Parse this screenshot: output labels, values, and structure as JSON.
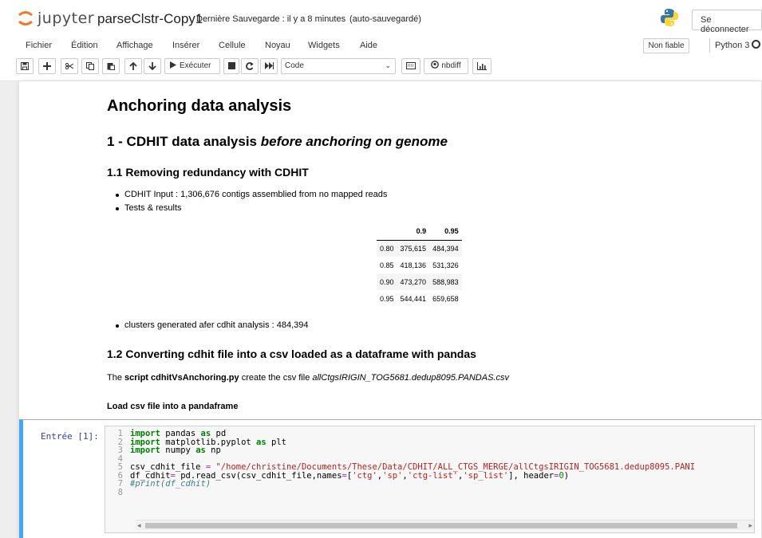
{
  "header": {
    "logo_text": "jupyter",
    "notebook_name": "parseClstr-Copy1",
    "save_status": "Dernière Sauvegarde : il y a 8 minutes",
    "autosave": "(auto-sauvegardé)",
    "logout": "Se déconnecter"
  },
  "menu": {
    "items": [
      "Fichier",
      "Édition",
      "Affichage",
      "Insérer",
      "Cellule",
      "Noyau",
      "Widgets",
      "Aide"
    ],
    "trust": "Non fiable",
    "kernel": "Python 3"
  },
  "toolbar": {
    "run_label": "Exécuter",
    "cell_type": "Code",
    "nbdiff_label": "nbdiff",
    "icons": [
      "save-icon",
      "plus-icon",
      "cut-icon",
      "copy-icon",
      "paste-icon",
      "arrow-up-icon",
      "arrow-down-icon",
      "play-icon",
      "stop-icon",
      "restart-icon",
      "fast-forward-icon",
      "keyboard-icon",
      "github-icon",
      "chart-bar-icon"
    ]
  },
  "markdown": {
    "h1": "Anchoring data analysis",
    "h2_prefix": "1 - CDHIT data analysis ",
    "h2_italic": "before anchoring on genome",
    "h3_1": "1.1 Removing redundancy with CDHIT",
    "bullets1": [
      "CDHIT Input : 1,306,676 contigs assemblied from no mapped reads",
      "Tests & results"
    ],
    "table": {
      "headers": [
        "",
        "0.9",
        "0.95"
      ],
      "rows": [
        [
          "0.80",
          "375,615",
          "484,394"
        ],
        [
          "0.85",
          "418,136",
          "531,326"
        ],
        [
          "0.90",
          "473,270",
          "588,983"
        ],
        [
          "0.95",
          "544,441",
          "659,658"
        ]
      ]
    },
    "bullets2": [
      "clusters generated afer cdhit analysis : 484,394"
    ],
    "h3_2": "1.2 Converting cdhit file into a csv loaded as a dataframe with pandas",
    "desc_prefix": "The ",
    "desc_bold": "script cdhitVsAnchoring.py",
    "desc_middle": " create the csv file ",
    "desc_italic": "allCtgsIRIGIN_TOG5681.dedup8095.PANDAS.csv",
    "load_title": "Load csv file into a pandaframe"
  },
  "code_cell": {
    "prompt": "Entrée [1]:",
    "line_numbers": [
      "1",
      "2",
      "3",
      "4",
      "5",
      "6",
      "7",
      "8"
    ],
    "lines": [
      "import pandas as pd",
      "import matplotlib.pyplot as plt",
      "import numpy as np",
      "",
      "csv_cdhit_file = \"/home/christine/Documents/These/Data/CDHIT/ALL_CTGS_MERGE/allCtgsIRIGIN_TOG5681.dedup8095.PANI",
      "df_cdhit= pd.read_csv(csv_cdhit_file,names=['ctg','sp','ctg-list','sp_list'], header=0)",
      "#print(df_cdhit)",
      ""
    ]
  },
  "colors": {
    "selected_cell_border": "#42a5f5",
    "prompt": "#303f9f",
    "keyword": "#008000",
    "string": "#ba2121",
    "comment": "#408080"
  }
}
